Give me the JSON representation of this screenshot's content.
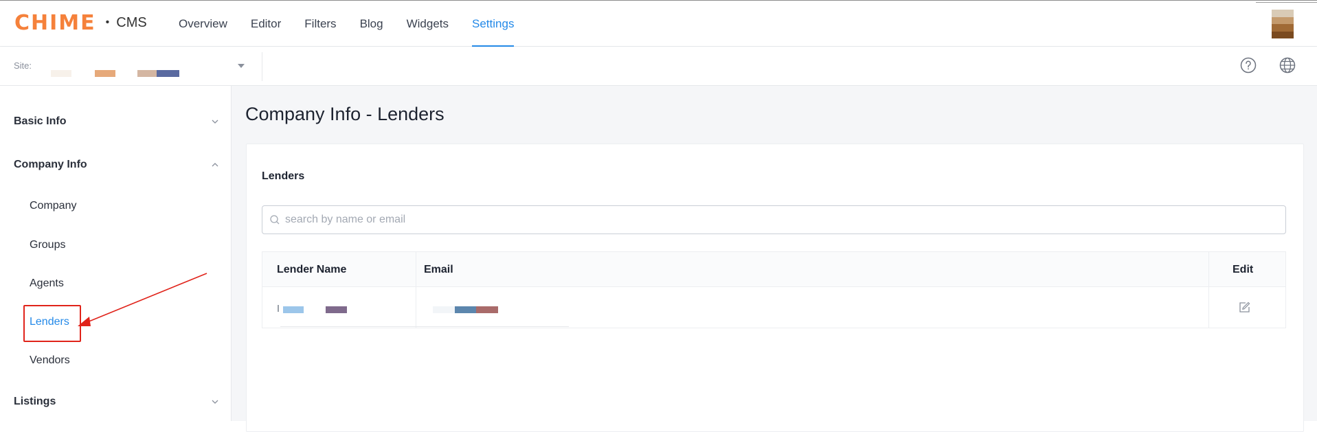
{
  "header": {
    "logo_text": "CHIME",
    "logo_separator": "•",
    "logo_product": "CMS",
    "nav": [
      {
        "label": "Overview",
        "active": false
      },
      {
        "label": "Editor",
        "active": false
      },
      {
        "label": "Filters",
        "active": false
      },
      {
        "label": "Blog",
        "active": false
      },
      {
        "label": "Widgets",
        "active": false
      },
      {
        "label": "Settings",
        "active": true
      }
    ],
    "avatar_colors": [
      "#d9cbb6",
      "#c49a6c",
      "#a06a35",
      "#7a4a1f"
    ]
  },
  "subbar": {
    "site_label": "Site:",
    "icons": [
      "help-icon",
      "globe-icon"
    ]
  },
  "sidebar": {
    "groups": [
      {
        "label": "Basic Info",
        "expanded": false
      },
      {
        "label": "Company Info",
        "expanded": true
      },
      {
        "label": "Listings",
        "expanded": false
      }
    ],
    "company_items": [
      {
        "label": "Company",
        "active": false
      },
      {
        "label": "Groups",
        "active": false
      },
      {
        "label": "Agents",
        "active": false
      },
      {
        "label": "Lenders",
        "active": true
      },
      {
        "label": "Vendors",
        "active": false
      }
    ]
  },
  "main": {
    "page_title": "Company Info - Lenders",
    "card_title": "Lenders",
    "search_placeholder": "search by name or email",
    "table": {
      "columns": [
        "Lender Name",
        "Email",
        "Edit"
      ]
    }
  },
  "colors": {
    "accent": "#2389e8",
    "brand": "#f5813b",
    "annotation": "#e0231a"
  }
}
